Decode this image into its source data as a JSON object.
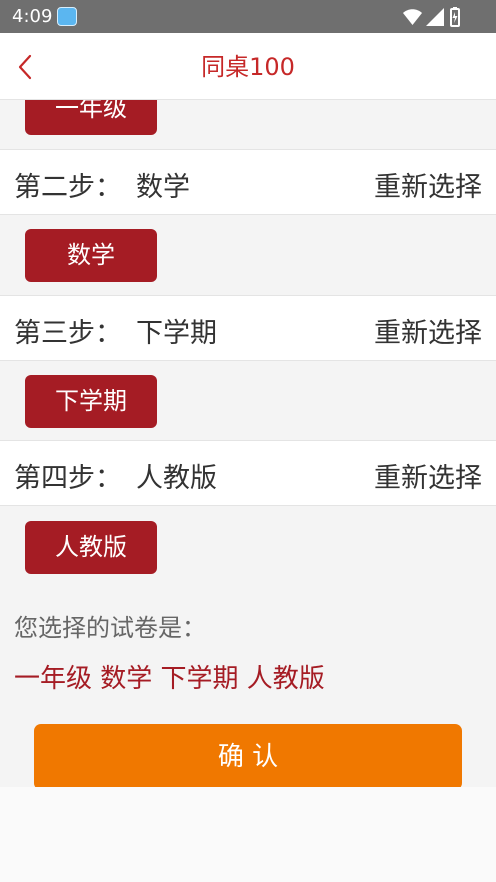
{
  "status": {
    "time": "4:09",
    "icons": [
      "app-notification-icon",
      "wifi-icon",
      "signal-icon",
      "battery-charging-icon"
    ]
  },
  "header": {
    "title": "同桌100",
    "back_icon": "chevron-left-icon",
    "accent_color": "#c62828"
  },
  "steps": {
    "grade_selected": "一年级",
    "step2": {
      "label": "第二步：",
      "value": "数学",
      "action": "重新选择",
      "selected_button": "数学"
    },
    "step3": {
      "label": "第三步：",
      "value": "下学期",
      "action": "重新选择",
      "selected_button": "下学期"
    },
    "step4": {
      "label": "第四步：",
      "value": "人教版",
      "action": "重新选择",
      "selected_button": "人教版"
    }
  },
  "summary": {
    "label": "您选择的试卷是：",
    "value": "一年级 数学 下学期 人教版"
  },
  "confirm": {
    "label": "确 认",
    "color": "#f07800"
  },
  "colors": {
    "button_red": "#a51c24",
    "background": "#f4f4f4"
  }
}
